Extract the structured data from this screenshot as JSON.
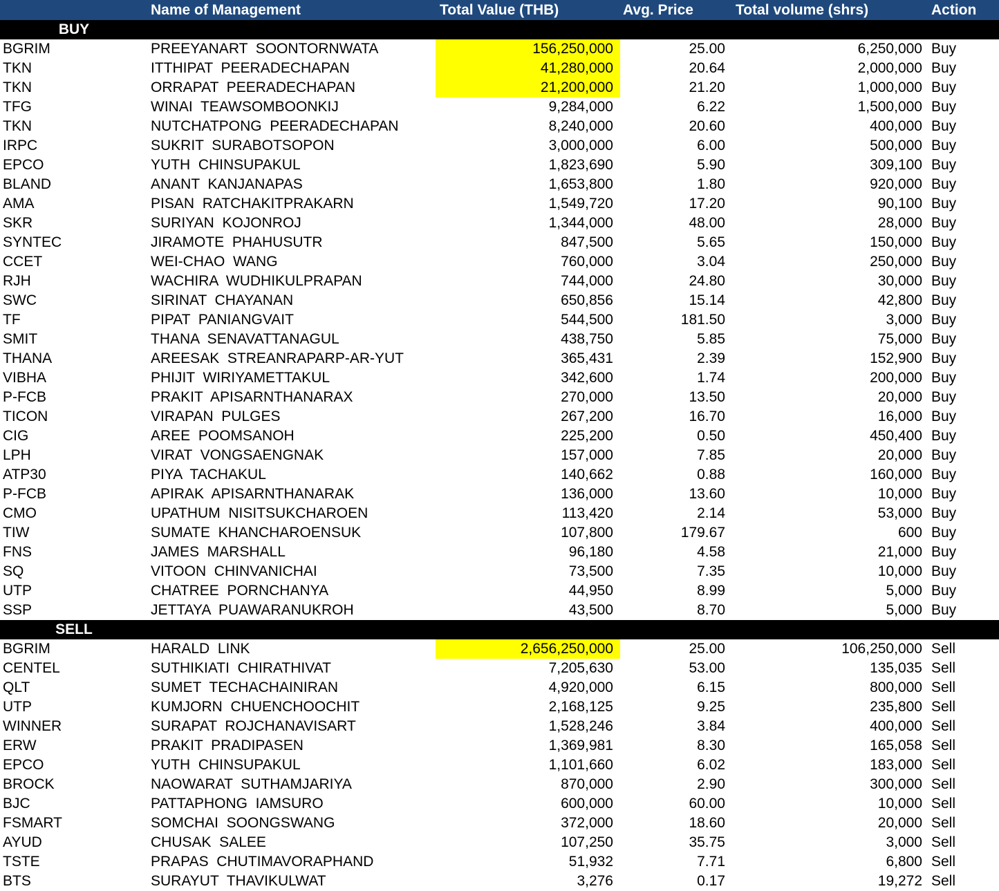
{
  "header": {
    "name": "Name of Management",
    "value": "Total Value (THB)",
    "avg": "Avg. Price",
    "volume": "Total volume (shrs)",
    "action": "Action"
  },
  "colors": {
    "header_bg": "#1f497d",
    "section_bg": "#000000",
    "highlight": "#ffff00"
  },
  "sections": [
    {
      "label": "BUY",
      "rows": [
        {
          "symbol": "BGRIM",
          "name": "PREEYANART  SOONTORNWATA",
          "value": "156,250,000",
          "avg": "25.00",
          "volume": "6,250,000",
          "action": "Buy",
          "highlight": true
        },
        {
          "symbol": "TKN",
          "name": "ITTHIPAT  PEERADECHAPAN",
          "value": "41,280,000",
          "avg": "20.64",
          "volume": "2,000,000",
          "action": "Buy",
          "highlight": true
        },
        {
          "symbol": "TKN",
          "name": "ORRAPAT  PEERADECHAPAN",
          "value": "21,200,000",
          "avg": "21.20",
          "volume": "1,000,000",
          "action": "Buy",
          "highlight": true
        },
        {
          "symbol": "TFG",
          "name": "WINAI  TEAWSOMBOONKIJ",
          "value": "9,284,000",
          "avg": "6.22",
          "volume": "1,500,000",
          "action": "Buy"
        },
        {
          "symbol": "TKN",
          "name": "NUTCHATPONG  PEERADECHAPAN",
          "value": "8,240,000",
          "avg": "20.60",
          "volume": "400,000",
          "action": "Buy"
        },
        {
          "symbol": "IRPC",
          "name": "SUKRIT  SURABOTSOPON",
          "value": "3,000,000",
          "avg": "6.00",
          "volume": "500,000",
          "action": "Buy"
        },
        {
          "symbol": "EPCO",
          "name": "YUTH  CHINSUPAKUL",
          "value": "1,823,690",
          "avg": "5.90",
          "volume": "309,100",
          "action": "Buy"
        },
        {
          "symbol": "BLAND",
          "name": "ANANT  KANJANAPAS",
          "value": "1,653,800",
          "avg": "1.80",
          "volume": "920,000",
          "action": "Buy"
        },
        {
          "symbol": "AMA",
          "name": "PISAN  RATCHAKITPRAKARN",
          "value": "1,549,720",
          "avg": "17.20",
          "volume": "90,100",
          "action": "Buy"
        },
        {
          "symbol": "SKR",
          "name": "SURIYAN  KOJONROJ",
          "value": "1,344,000",
          "avg": "48.00",
          "volume": "28,000",
          "action": "Buy"
        },
        {
          "symbol": "SYNTEC",
          "name": "JIRAMOTE  PHAHUSUTR",
          "value": "847,500",
          "avg": "5.65",
          "volume": "150,000",
          "action": "Buy"
        },
        {
          "symbol": "CCET",
          "name": "WEI-CHAO  WANG",
          "value": "760,000",
          "avg": "3.04",
          "volume": "250,000",
          "action": "Buy"
        },
        {
          "symbol": "RJH",
          "name": "WACHIRA  WUDHIKULPRAPAN",
          "value": "744,000",
          "avg": "24.80",
          "volume": "30,000",
          "action": "Buy"
        },
        {
          "symbol": "SWC",
          "name": "SIRINAT  CHAYANAN",
          "value": "650,856",
          "avg": "15.14",
          "volume": "42,800",
          "action": "Buy"
        },
        {
          "symbol": "TF",
          "name": "PIPAT  PANIANGVAIT",
          "value": "544,500",
          "avg": "181.50",
          "volume": "3,000",
          "action": "Buy"
        },
        {
          "symbol": "SMIT",
          "name": "THANA  SENAVATTANAGUL",
          "value": "438,750",
          "avg": "5.85",
          "volume": "75,000",
          "action": "Buy"
        },
        {
          "symbol": "THANA",
          "name": "AREESAK  STREANRAPARP-AR-YUT",
          "value": "365,431",
          "avg": "2.39",
          "volume": "152,900",
          "action": "Buy"
        },
        {
          "symbol": "VIBHA",
          "name": "PHIJIT  WIRIYAMETTAKUL",
          "value": "342,600",
          "avg": "1.74",
          "volume": "200,000",
          "action": "Buy"
        },
        {
          "symbol": "P-FCB",
          "name": "PRAKIT  APISARNTHANARAX",
          "value": "270,000",
          "avg": "13.50",
          "volume": "20,000",
          "action": "Buy"
        },
        {
          "symbol": "TICON",
          "name": "VIRAPAN  PULGES",
          "value": "267,200",
          "avg": "16.70",
          "volume": "16,000",
          "action": "Buy"
        },
        {
          "symbol": "CIG",
          "name": "AREE  POOMSANOH",
          "value": "225,200",
          "avg": "0.50",
          "volume": "450,400",
          "action": "Buy"
        },
        {
          "symbol": "LPH",
          "name": "VIRAT  VONGSAENGNAK",
          "value": "157,000",
          "avg": "7.85",
          "volume": "20,000",
          "action": "Buy"
        },
        {
          "symbol": "ATP30",
          "name": "PIYA  TACHAKUL",
          "value": "140,662",
          "avg": "0.88",
          "volume": "160,000",
          "action": "Buy"
        },
        {
          "symbol": "P-FCB",
          "name": "APIRAK  APISARNTHANARAK",
          "value": "136,000",
          "avg": "13.60",
          "volume": "10,000",
          "action": "Buy"
        },
        {
          "symbol": "CMO",
          "name": "UPATHUM  NISITSUKCHAROEN",
          "value": "113,420",
          "avg": "2.14",
          "volume": "53,000",
          "action": "Buy"
        },
        {
          "symbol": "TIW",
          "name": "SUMATE  KHANCHAROENSUK",
          "value": "107,800",
          "avg": "179.67",
          "volume": "600",
          "action": "Buy"
        },
        {
          "symbol": "FNS",
          "name": "JAMES  MARSHALL",
          "value": "96,180",
          "avg": "4.58",
          "volume": "21,000",
          "action": "Buy"
        },
        {
          "symbol": "SQ",
          "name": "VITOON  CHINVANICHAI",
          "value": "73,500",
          "avg": "7.35",
          "volume": "10,000",
          "action": "Buy"
        },
        {
          "symbol": "UTP",
          "name": "CHATREE  PORNCHANYA",
          "value": "44,950",
          "avg": "8.99",
          "volume": "5,000",
          "action": "Buy"
        },
        {
          "symbol": "SSP",
          "name": "JETTAYA  PUAWARANUKROH",
          "value": "43,500",
          "avg": "8.70",
          "volume": "5,000",
          "action": "Buy"
        }
      ]
    },
    {
      "label": "SELL",
      "rows": [
        {
          "symbol": "BGRIM",
          "name": "HARALD  LINK",
          "value": "2,656,250,000",
          "avg": "25.00",
          "volume": "106,250,000",
          "action": "Sell",
          "highlight": true
        },
        {
          "symbol": "CENTEL",
          "name": "SUTHIKIATI  CHIRATHIVAT",
          "value": "7,205,630",
          "avg": "53.00",
          "volume": "135,035",
          "action": "Sell"
        },
        {
          "symbol": "QLT",
          "name": "SUMET  TECHACHAINIRAN",
          "value": "4,920,000",
          "avg": "6.15",
          "volume": "800,000",
          "action": "Sell"
        },
        {
          "symbol": "UTP",
          "name": "KUMJORN  CHUENCHOOCHIT",
          "value": "2,168,125",
          "avg": "9.25",
          "volume": "235,800",
          "action": "Sell"
        },
        {
          "symbol": "WINNER",
          "name": "SURAPAT  ROJCHANAVISART",
          "value": "1,528,246",
          "avg": "3.84",
          "volume": "400,000",
          "action": "Sell"
        },
        {
          "symbol": "ERW",
          "name": "PRAKIT  PRADIPASEN",
          "value": "1,369,981",
          "avg": "8.30",
          "volume": "165,058",
          "action": "Sell"
        },
        {
          "symbol": "EPCO",
          "name": "YUTH  CHINSUPAKUL",
          "value": "1,101,660",
          "avg": "6.02",
          "volume": "183,000",
          "action": "Sell"
        },
        {
          "symbol": "BROCK",
          "name": "NAOWARAT  SUTHAMJARIYA",
          "value": "870,000",
          "avg": "2.90",
          "volume": "300,000",
          "action": "Sell"
        },
        {
          "symbol": "BJC",
          "name": "PATTAPHONG  IAMSURO",
          "value": "600,000",
          "avg": "60.00",
          "volume": "10,000",
          "action": "Sell"
        },
        {
          "symbol": "FSMART",
          "name": "SOMCHAI  SOONGSWANG",
          "value": "372,000",
          "avg": "18.60",
          "volume": "20,000",
          "action": "Sell"
        },
        {
          "symbol": "AYUD",
          "name": "CHUSAK  SALEE",
          "value": "107,250",
          "avg": "35.75",
          "volume": "3,000",
          "action": "Sell"
        },
        {
          "symbol": "TSTE",
          "name": "PRAPAS  CHUTIMAVORAPHAND",
          "value": "51,932",
          "avg": "7.71",
          "volume": "6,800",
          "action": "Sell"
        },
        {
          "symbol": "BTS",
          "name": "SURAYUT  THAVIKULWAT",
          "value": "3,276",
          "avg": "0.17",
          "volume": "19,272",
          "action": "Sell"
        }
      ]
    }
  ]
}
